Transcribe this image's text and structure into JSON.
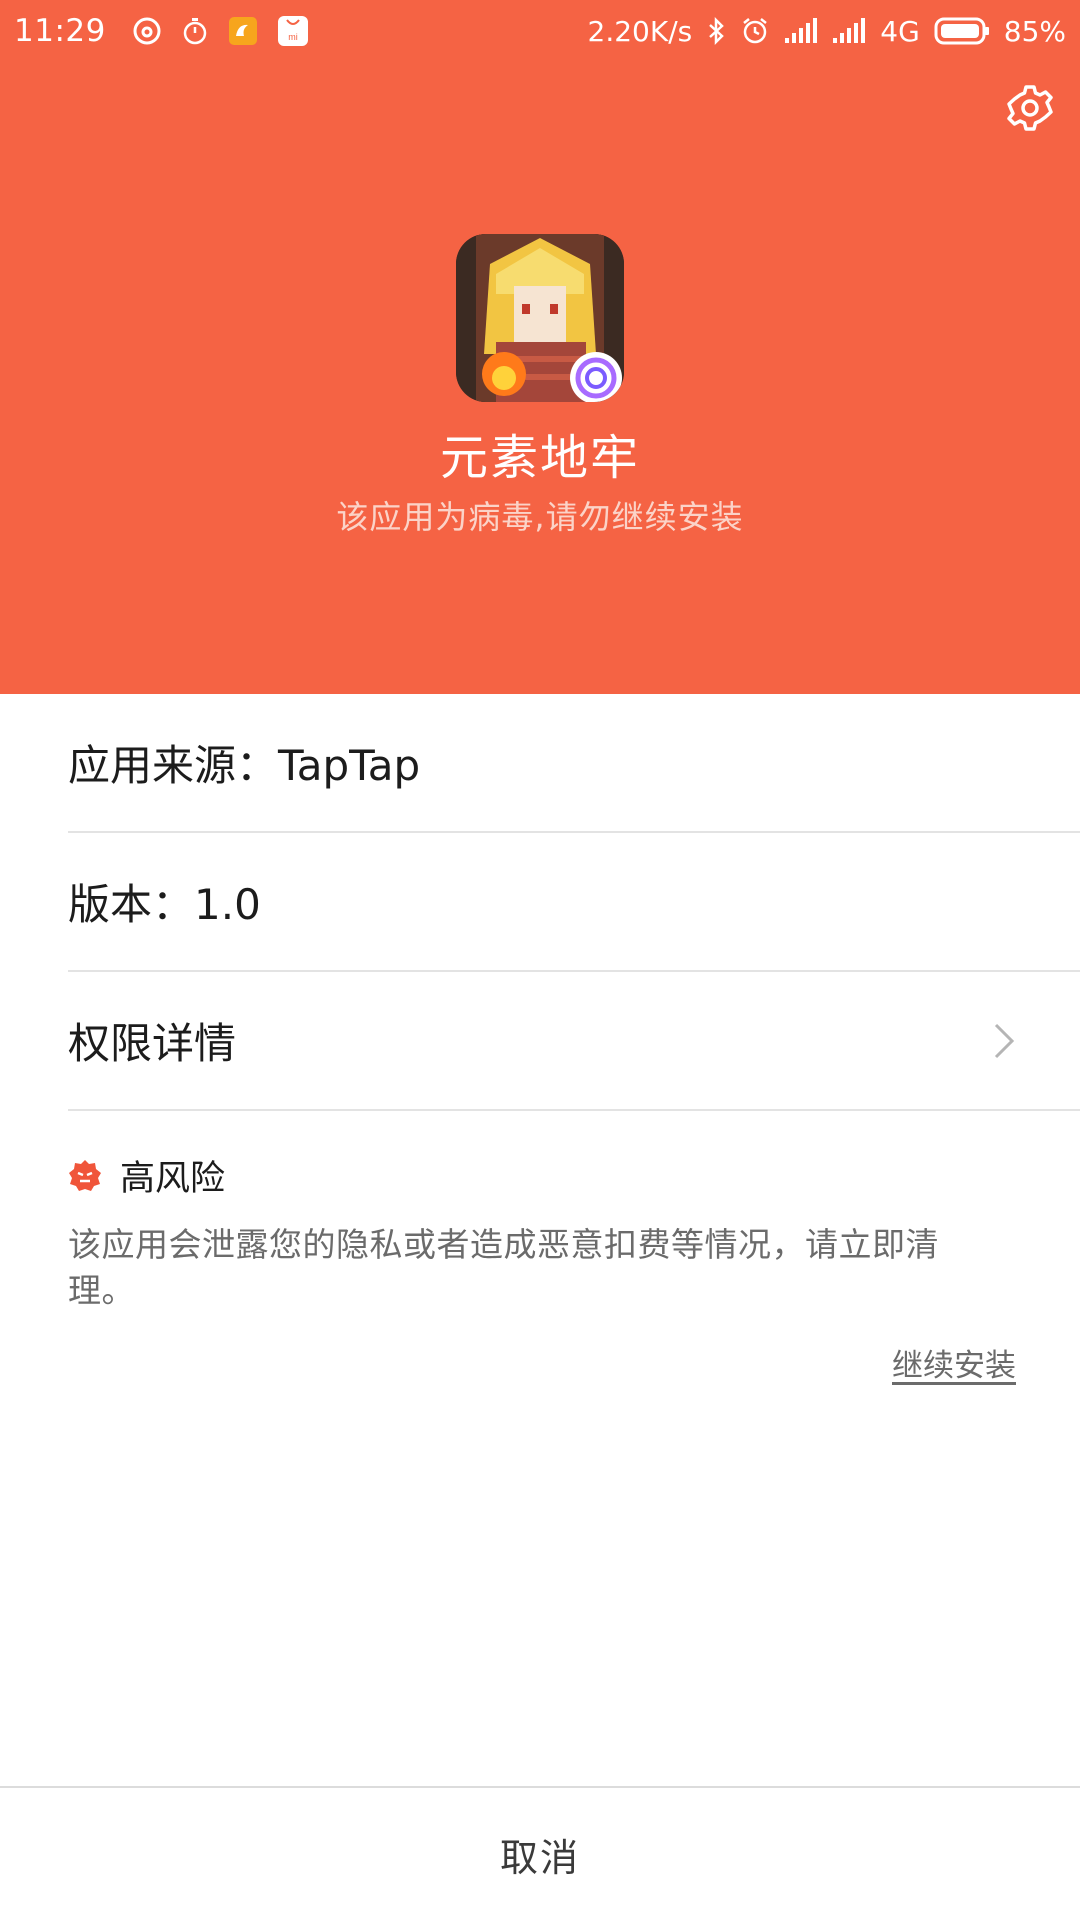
{
  "status_bar": {
    "time": "11:29",
    "speed": "2.20K/s",
    "network": "4G",
    "battery": "85%",
    "notification_icons": [
      "netease-music-icon",
      "stopwatch-icon",
      "uc-browser-icon",
      "mi-store-icon"
    ],
    "status_icons": [
      "bluetooth-icon",
      "alarm-icon",
      "signal-icon",
      "signal-icon",
      "battery-icon"
    ]
  },
  "header": {
    "background_color": "#f56344",
    "app_name": "元素地牢",
    "warning": "该应用为病毒,请勿继续安装",
    "settings_icon": "gear-icon"
  },
  "details": {
    "source": "应用来源：TapTap",
    "version": "版本：1.0",
    "permissions": "权限详情"
  },
  "risk": {
    "label": "高风险",
    "description": "该应用会泄露您的隐私或者造成恶意扣费等情况，请立即清理。",
    "continue_link": "继续安装",
    "accent_color": "#f0553a"
  },
  "footer": {
    "cancel": "取消"
  }
}
